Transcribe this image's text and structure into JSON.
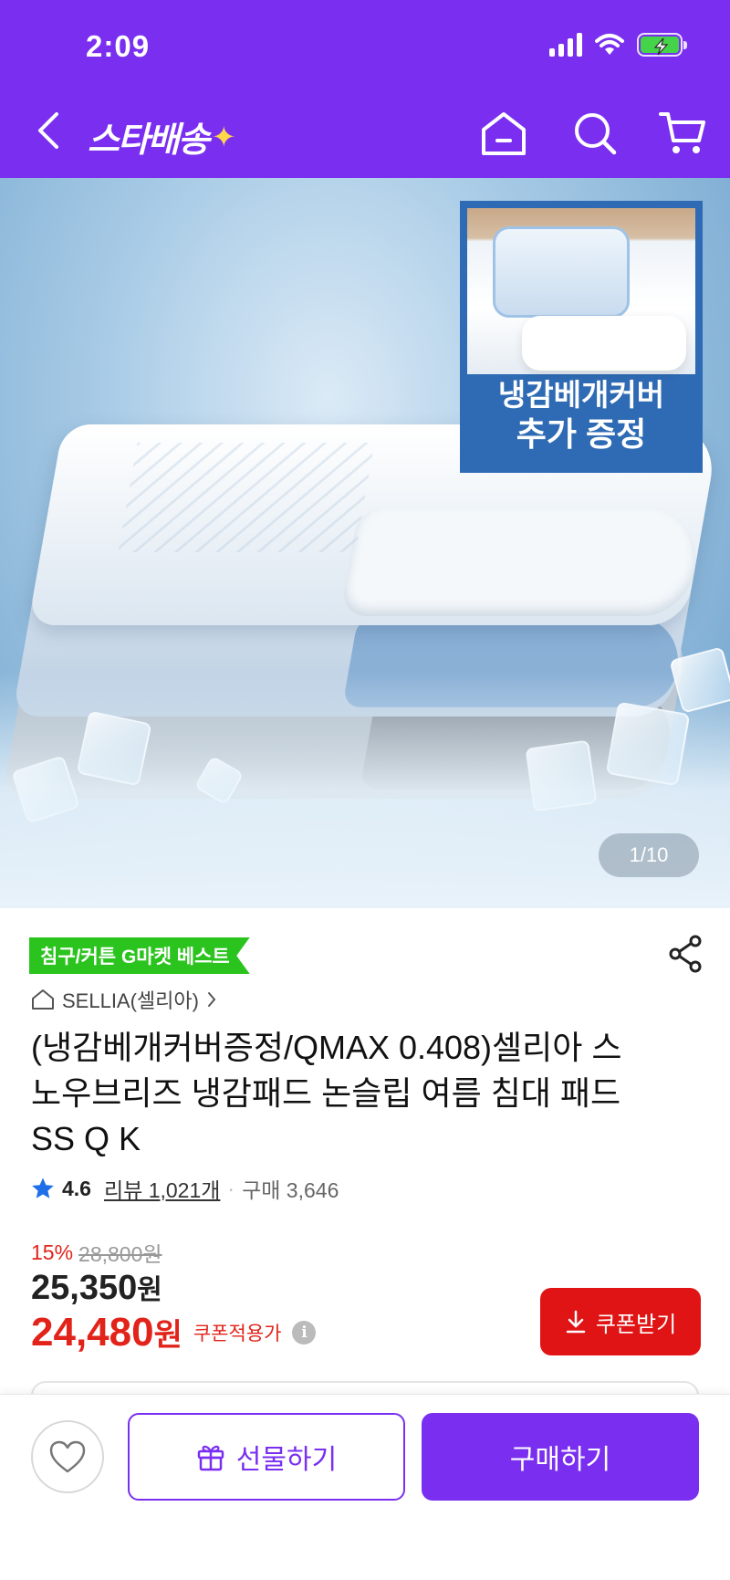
{
  "status_bar": {
    "time": "2:09",
    "icons": [
      "signal-icon",
      "wifi-icon",
      "battery-charging-icon"
    ]
  },
  "header": {
    "brand": "스타배송",
    "back_icon": "chevron-left-icon",
    "actions": [
      "home-icon",
      "search-icon",
      "cart-icon"
    ]
  },
  "hero": {
    "inset_line1": "냉감베개커버",
    "inset_line2": "추가 증정",
    "page_counter": "1/10"
  },
  "product": {
    "best_badge": "침구/커튼 G마켓 베스트",
    "store": "SELLIA(셀리아)",
    "title": "(냉감베개커버증정/QMAX 0.408)셀리아 스노우브리즈 냉감패드 논슬립 여름 침대 패드 SS Q K",
    "rating": "4.6",
    "reviews": "리뷰 1,021개",
    "purchases": "구매 3,646",
    "discount_rate": "15%",
    "original_price": "28,800원",
    "sale_price": "25,350",
    "coupon_price": "24,480",
    "price_unit": "원",
    "coupon_price_label": "쿠폰적용가",
    "coupon_button": "쿠폰받기"
  },
  "bottom_bar": {
    "gift_label": "선물하기",
    "buy_label": "구매하기"
  },
  "colors": {
    "brand_purple": "#7a2ff0",
    "price_red": "#e2231a",
    "badge_green": "#2bc41e",
    "coupon_red": "#e01414"
  }
}
